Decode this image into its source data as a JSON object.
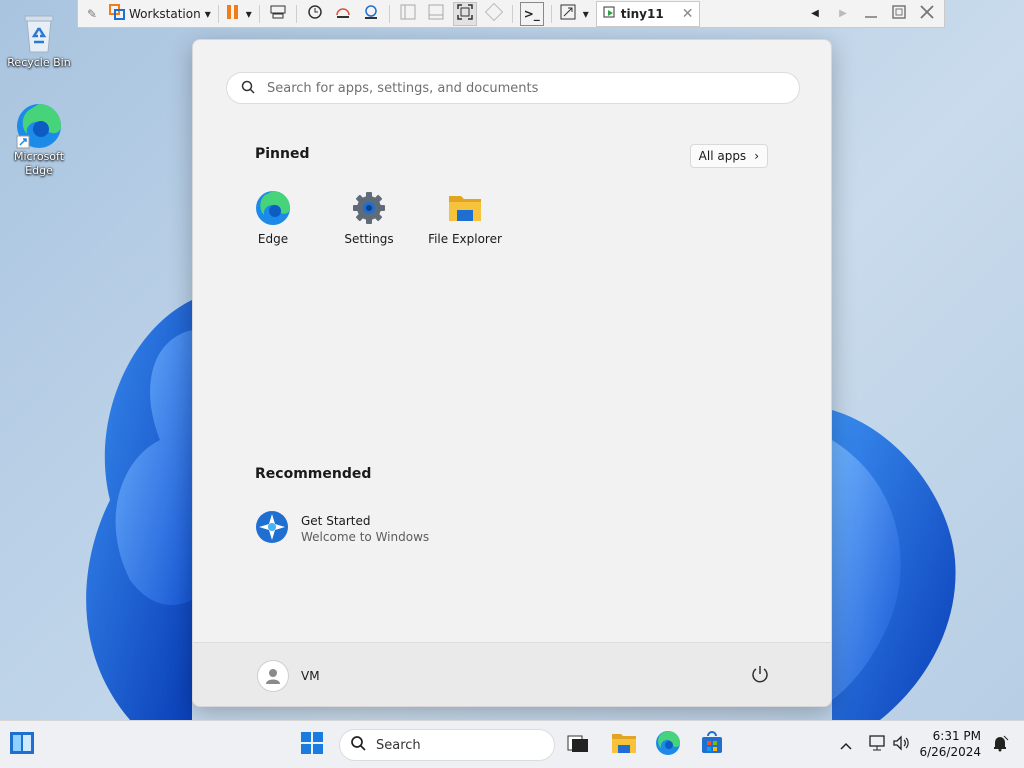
{
  "desktop": {
    "icons": [
      {
        "label": "Recycle Bin",
        "icon": "recycle-bin-icon"
      },
      {
        "label": "Microsoft Edge",
        "icon": "edge-icon"
      }
    ]
  },
  "vm_toolbar": {
    "menu_label": "Workstation",
    "tab_name": "tiny11",
    "tab_close": "✕"
  },
  "start_menu": {
    "search_placeholder": "Search for apps, settings, and documents",
    "pinned_title": "Pinned",
    "all_apps_label": "All apps",
    "pinned_apps": [
      {
        "label": "Edge",
        "icon": "edge-icon"
      },
      {
        "label": "Settings",
        "icon": "settings-gear-icon"
      },
      {
        "label": "File Explorer",
        "icon": "folder-icon"
      }
    ],
    "recommended_title": "Recommended",
    "recommended": [
      {
        "title": "Get Started",
        "subtitle": "Welcome to Windows",
        "icon": "get-started-icon"
      }
    ],
    "user_name": "VM"
  },
  "taskbar": {
    "search_label": "Search",
    "time": "6:31 PM",
    "date": "6/26/2024"
  },
  "colors": {
    "accent": "#0067c0",
    "pause_orange": "#f07d1a",
    "folder_yellow": "#f7c33d"
  }
}
